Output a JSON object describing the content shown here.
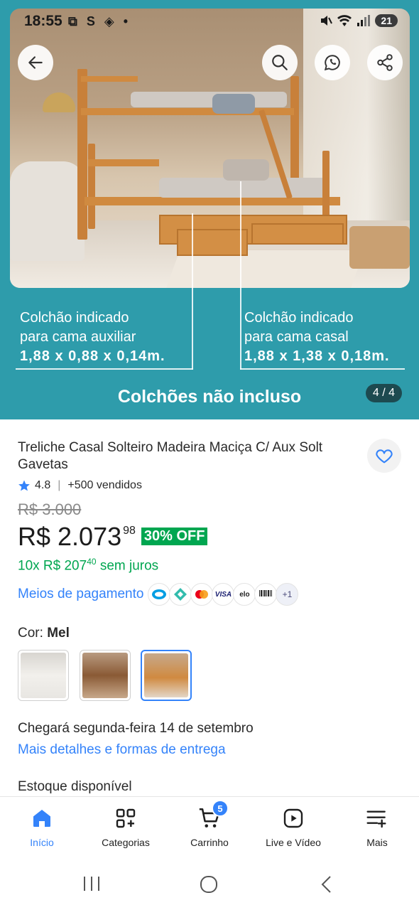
{
  "status_bar": {
    "time": "18:55",
    "left_icons": "⧉ S ◈ •",
    "battery": "21"
  },
  "hero": {
    "left_caption": {
      "line1": "Colchão indicado",
      "line2": "para cama auxiliar",
      "dims": "1,88 x 0,88 x 0,14m."
    },
    "right_caption": {
      "line1": "Colchão indicado",
      "line2": "para cama casal",
      "dims": "1,88 x 1,38 x 0,18m."
    },
    "headline": "Colchões não incluso",
    "counter": "4 / 4",
    "bg_color": "#2e9cab"
  },
  "product": {
    "title": "Treliche Casal Solteiro Madeira Maciça C/ Aux Solt Gavetas",
    "rating": "4.8",
    "sold": "+500 vendidos",
    "old_price": "R$ 3.000",
    "price_main": "R$ 2.073",
    "price_cents": "98",
    "discount": "30% OFF",
    "installments_prefix": "10x R$ 207",
    "installments_cents": "40",
    "installments_suffix": " sem juros",
    "payments_link": "Meios de pagamento",
    "payment_methods": [
      "Mercado Pago",
      "Pix",
      "Mastercard",
      "VISA",
      "elo",
      "Boleto"
    ],
    "payment_more": "+1",
    "color_label": "Cor: ",
    "color_value": "Mel",
    "delivery_prefix": "Chegará segunda-feira ",
    "delivery_day": "14",
    "delivery_suffix": " de setembro",
    "delivery_link": "Mais detalhes e formas de entrega",
    "stock": "Estoque disponível"
  },
  "nav": {
    "tabs": [
      {
        "label": "Início",
        "icon": "home-icon"
      },
      {
        "label": "Categorias",
        "icon": "categories-icon"
      },
      {
        "label": "Carrinho",
        "icon": "cart-icon",
        "badge": "5"
      },
      {
        "label": "Live e Vídeo",
        "icon": "video-icon"
      },
      {
        "label": "Mais",
        "icon": "more-icon"
      }
    ]
  },
  "colors": {
    "accent": "#3483fa",
    "success": "#00a650"
  }
}
